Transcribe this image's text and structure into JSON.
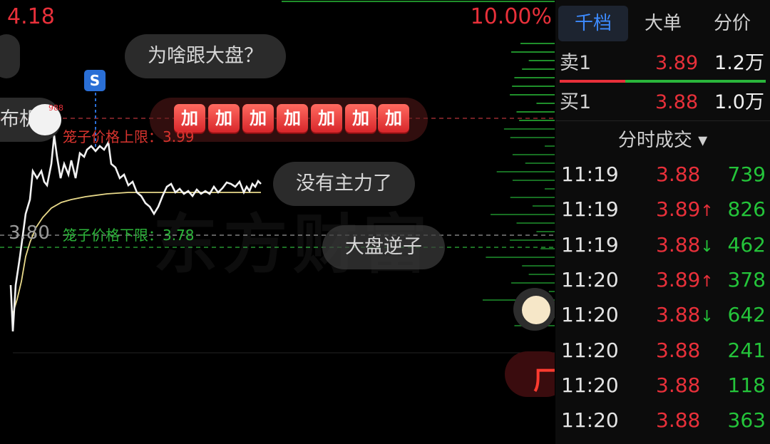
{
  "chart": {
    "price_high": "4.18",
    "pct_high": "10.00%",
    "price_mid": "3.80",
    "cage_upper_label": "笼子价格上限：3.99",
    "cage_lower_label": "笼子价格下限：3.78",
    "watermark": "东方财富",
    "s_marker": "S",
    "emoji_badge": "988",
    "plus_label": "加",
    "buy_glyph": "厂"
  },
  "comments": [
    {
      "text": "为啥跟大盘？"
    },
    {
      "text": "没有主力了"
    },
    {
      "text": "大盘逆子"
    },
    {
      "text": "布机"
    }
  ],
  "tabs": [
    {
      "label": "千档",
      "active": true
    },
    {
      "label": "大单",
      "active": false
    },
    {
      "label": "分价",
      "active": false
    }
  ],
  "order_book": {
    "sell": {
      "label": "卖1",
      "price": "3.89",
      "volume": "1.2万"
    },
    "buy": {
      "label": "买1",
      "price": "3.88",
      "volume": "1.0万"
    },
    "buy_ratio": 0.32
  },
  "ticks_title": "分时成交 ▾",
  "ticks": [
    {
      "time": "11:19",
      "price": "3.88",
      "arrow": "",
      "volume": "739"
    },
    {
      "time": "11:19",
      "price": "3.89",
      "arrow": "↑",
      "volume": "826"
    },
    {
      "time": "11:19",
      "price": "3.88",
      "arrow": "↓",
      "volume": "462"
    },
    {
      "time": "11:20",
      "price": "3.89",
      "arrow": "↑",
      "volume": "378"
    },
    {
      "time": "11:20",
      "price": "3.88",
      "arrow": "↓",
      "volume": "642"
    },
    {
      "time": "11:20",
      "price": "3.88",
      "arrow": "",
      "volume": "241"
    },
    {
      "time": "11:20",
      "price": "3.88",
      "arrow": "",
      "volume": "118"
    },
    {
      "time": "11:20",
      "price": "3.88",
      "arrow": "",
      "volume": "363"
    }
  ],
  "colors": {
    "up": "#e8303a",
    "down": "#24c43a",
    "accent": "#3d8bff",
    "avg_line": "#e8d98a"
  }
}
